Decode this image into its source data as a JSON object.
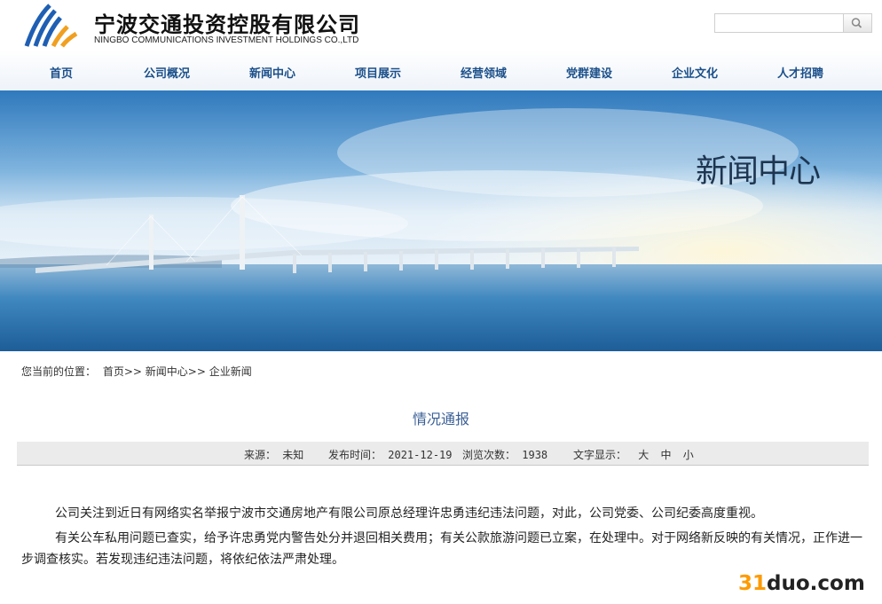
{
  "header": {
    "brand_cn": "宁波交通投资控股有限公司",
    "brand_en": "NINGBO COMMUNICATIONS INVESTMENT HOLDINGS CO.,LTD",
    "search_placeholder": "",
    "search_icon": "search-icon"
  },
  "nav": {
    "items": [
      "首页",
      "公司概况",
      "新闻中心",
      "项目展示",
      "经营领域",
      "党群建设",
      "企业文化",
      "人才招聘"
    ]
  },
  "banner": {
    "title": "新闻中心"
  },
  "breadcrumb": {
    "prefix": "您当前的位置：",
    "items": [
      "首页>>",
      "新闻中心>>",
      "企业新闻"
    ]
  },
  "article": {
    "title": "情况通报",
    "meta": {
      "source_label": "来源：",
      "source_value": "未知",
      "date_label": "发布时间：",
      "date_value": "2021-12-19",
      "views_label": "浏览次数：",
      "views_value": "1938",
      "size_label": "文字显示：",
      "size_options": [
        "大",
        "中",
        "小"
      ]
    },
    "paragraphs": [
      "公司关注到近日有网络实名举报宁波市交通房地产有限公司原总经理许忠勇违纪违法问题，对此，公司党委、公司纪委高度重视。",
      "有关公车私用问题已查实，给予许忠勇党内警告处分并退回相关费用；有关公款旅游问题已立案，在处理中。对于网络新反映的有关情况，正作进一步调查核实。若发现违纪违法问题，将依纪依法严肃处理。"
    ]
  },
  "watermark": {
    "accent": "31",
    "rest": "duo.com"
  },
  "colors": {
    "nav_text": "#1a4f8a",
    "title_text": "#3a5f96",
    "logo_blue": "#1e5fb3",
    "logo_orange": "#f0a020"
  }
}
